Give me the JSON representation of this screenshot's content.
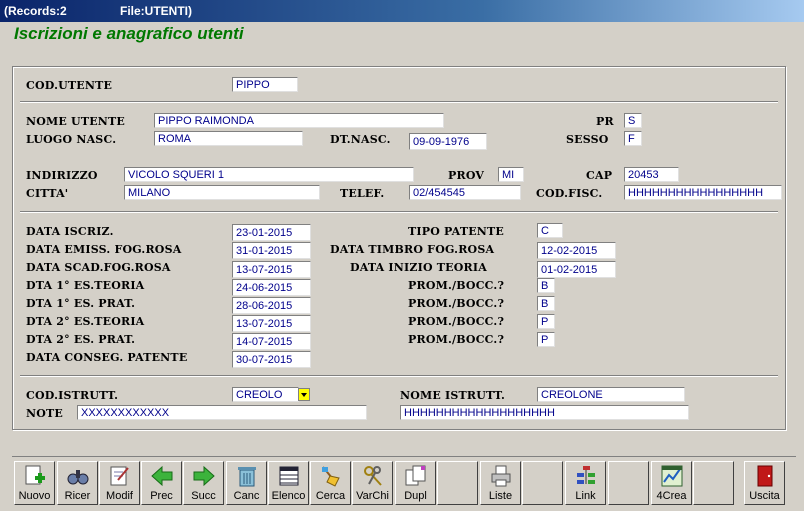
{
  "window": {
    "records": "(Records:2",
    "file": "File:UTENTI)"
  },
  "app_title": "Iscrizioni e anagrafico utenti",
  "fields": {
    "cod_utente": {
      "label": "COD.UTENTE",
      "value": "PIPPO"
    },
    "nome_utente": {
      "label": "NOME UTENTE",
      "value": "PIPPO RAIMONDA"
    },
    "pr": {
      "label": "PR",
      "value": "S"
    },
    "luogo_nasc": {
      "label": "LUOGO NASC.",
      "value": "ROMA"
    },
    "dt_nasc": {
      "label": "DT.NASC.",
      "value": "09-09-1976"
    },
    "sesso": {
      "label": "SESSO",
      "value": "F"
    },
    "indirizzo": {
      "label": "INDIRIZZO",
      "value": "VICOLO SQUERI 1"
    },
    "prov": {
      "label": "PROV",
      "value": "MI"
    },
    "cap": {
      "label": "CAP",
      "value": "20453"
    },
    "citta": {
      "label": "CITTA'",
      "value": "MILANO"
    },
    "telef": {
      "label": "TELEF.",
      "value": "02/454545"
    },
    "cod_fisc": {
      "label": "COD.FISC.",
      "value": "HHHHHHHHHHHHHHHHH"
    },
    "data_iscriz": {
      "label": "DATA ISCRIZ.",
      "value": "23-01-2015"
    },
    "data_emiss": {
      "label": "DATA EMISS. FOG.ROSA",
      "value": "31-01-2015"
    },
    "data_scad": {
      "label": "DATA SCAD.FOG.ROSA",
      "value": "13-07-2015"
    },
    "dta1_teoria": {
      "label": "DTA 1° ES.TEORIA",
      "value": "24-06-2015"
    },
    "dta1_prat": {
      "label": "DTA 1° ES. PRAT.",
      "value": "28-06-2015"
    },
    "dta2_teoria": {
      "label": "DTA 2° ES.TEORIA",
      "value": "13-07-2015"
    },
    "dta2_prat": {
      "label": "DTA 2° ES. PRAT.",
      "value": "14-07-2015"
    },
    "data_conseg": {
      "label": "DATA CONSEG. PATENTE",
      "value": "30-07-2015"
    },
    "tipo_patente": {
      "label": "TIPO PATENTE",
      "value": "C"
    },
    "data_timbro": {
      "label": "DATA TIMBRO FOG.ROSA",
      "value": "12-02-2015"
    },
    "data_inizio": {
      "label": "DATA INIZIO TEORIA",
      "value": "01-02-2015"
    },
    "prom1": {
      "label": "PROM./BOCC.?",
      "value": "B"
    },
    "prom2": {
      "label": "PROM./BOCC.?",
      "value": "B"
    },
    "prom3": {
      "label": "PROM./BOCC.?",
      "value": "P"
    },
    "prom4": {
      "label": "PROM./BOCC.?",
      "value": "P"
    },
    "cod_istrutt": {
      "label": "COD.ISTRUTT.",
      "value": "CREOLO"
    },
    "nome_istrutt": {
      "label": "NOME ISTRUTT.",
      "value": "CREOLONE"
    },
    "note": {
      "label": "NOTE",
      "value": "XXXXXXXXXXXX"
    },
    "note2": {
      "value": "HHHHHHHHHHHHHHHHHHH"
    }
  },
  "toolbar": {
    "nuovo": "Nuovo",
    "ricer": "Ricer",
    "modif": "Modif",
    "prec": "Prec",
    "succ": "Succ",
    "canc": "Canc",
    "elenco": "Elenco",
    "cerca": "Cerca",
    "varchi": "VarChi",
    "dupl": "Dupl",
    "liste": "Liste",
    "link": "Link",
    "crea4": "4Crea",
    "uscita": "Uscita"
  },
  "colors": {
    "title_green": "#007800",
    "field_text": "#00008b",
    "dropdown": "#ffff00"
  }
}
